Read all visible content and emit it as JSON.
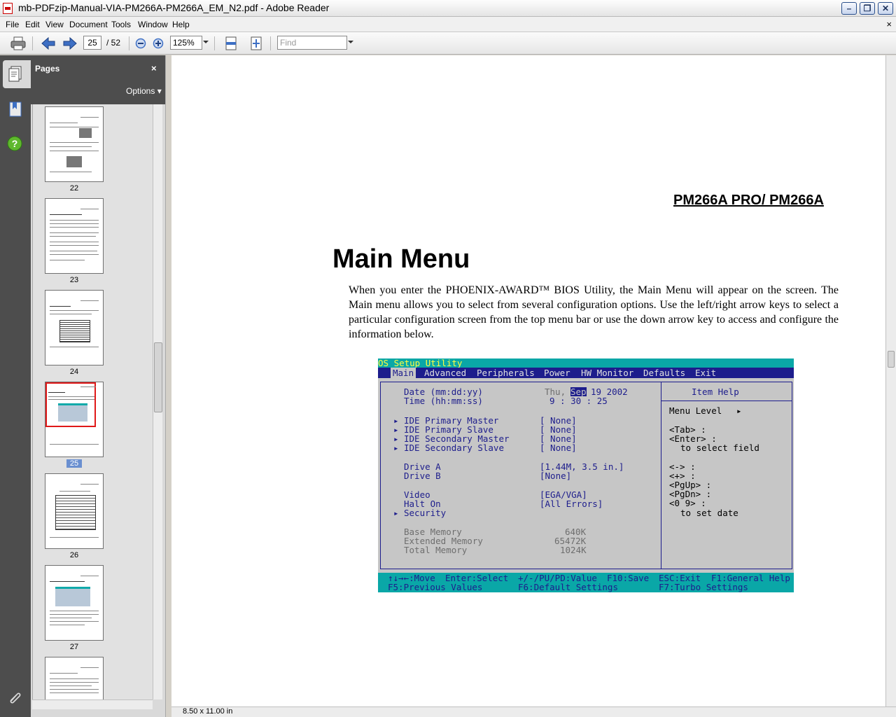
{
  "window": {
    "title": "mb-PDFzip-Manual-VIA-PM266A-PM266A_EM_N2.pdf - Adobe Reader",
    "minimize": "–",
    "maximize": "❐",
    "close": "✕"
  },
  "menu": {
    "file": "File",
    "edit": "Edit",
    "view": "View",
    "document": "Document",
    "tools": "Tools",
    "window": "Window",
    "help": "Help",
    "close_doc": "×"
  },
  "toolbar": {
    "current_page": "25",
    "page_total": "/ 52",
    "zoom": "125%",
    "find_placeholder": "Find"
  },
  "sidebar": {
    "title": "Pages",
    "close": "×",
    "options": "Options ▾",
    "selected_page": "25",
    "thumbnails": [
      {
        "label": "22"
      },
      {
        "label": "23"
      },
      {
        "label": "24"
      },
      {
        "label": "25"
      },
      {
        "label": "26"
      },
      {
        "label": "27"
      }
    ]
  },
  "status": {
    "page_size": "8.50 x 11.00 in"
  },
  "page": {
    "header_model": "PM266A PRO/ PM266A",
    "title": "Main Menu",
    "paragraph": "When you enter the PHOENIX-AWARD™ BIOS Utility, the Main Menu will appear on the screen. The Main menu allows you to select from several configuration options. Use the left/right arrow keys to select a particular configuration screen from the top menu bar or use the down arrow key to access and configure the information below."
  },
  "bios": {
    "top_title": "OS Setup Utility",
    "menu": {
      "main": "Main",
      "advanced": "Advanced",
      "peripherals": "Peripherals",
      "power": "Power",
      "hw_monitor": "HW Monitor",
      "defaults": "Defaults",
      "exit": "Exit"
    },
    "date_label": "Date (mm:dd:yy)",
    "date_day": "Thu,",
    "date_month": "Sep",
    "date_rest": "19 2002",
    "time_label": "Time (hh:mm:ss)",
    "time_value": "9 : 30 : 25",
    "arrow": "▸",
    "ide_pm_label": "IDE Primary Master",
    "ide_pm_value": "[ None]",
    "ide_ps_label": "IDE Primary Slave",
    "ide_ps_value": "[ None]",
    "ide_sm_label": "IDE Secondary Master",
    "ide_sm_value": "[ None]",
    "ide_ss_label": "IDE Secondary Slave",
    "ide_ss_value": "[ None]",
    "drive_a_label": "Drive A",
    "drive_a_value": "[1.44M, 3.5 in.]",
    "drive_b_label": "Drive B",
    "drive_b_value": "[None]",
    "video_label": "Video",
    "video_value": "[EGA/VGA]",
    "halt_label": "Halt On",
    "halt_value": "[All Errors]",
    "security_label": "Security",
    "base_mem_label": "Base Memory",
    "base_mem_value": "640K",
    "ext_mem_label": "Extended Memory",
    "ext_mem_value": "65472K",
    "total_mem_label": "Total Memory",
    "total_mem_value": "1024K",
    "help_title": "Item Help",
    "menu_level": "Menu Level",
    "menu_level_arrow": "▸",
    "help_tab": "<Tab> :",
    "help_enter": "<Enter> :",
    "help_select_field": "to select field",
    "help_minus": "<-> :",
    "help_plus": "<+> :",
    "help_pgup": "<PgUp> :",
    "help_pgdn": "<PgDn> :",
    "help_09": "<0 9> :",
    "help_set_date": "to set date",
    "footer_move": "↑↓→←:Move",
    "footer_select": "Enter:Select",
    "footer_value": "+/-/PU/PD:Value",
    "footer_save": "F10:Save",
    "footer_exit": "ESC:Exit",
    "footer_help": "F1:General Help",
    "footer_prev": "F5:Previous Values",
    "footer_default": "F6:Default Settings",
    "footer_turbo": "F7:Turbo Settings"
  }
}
